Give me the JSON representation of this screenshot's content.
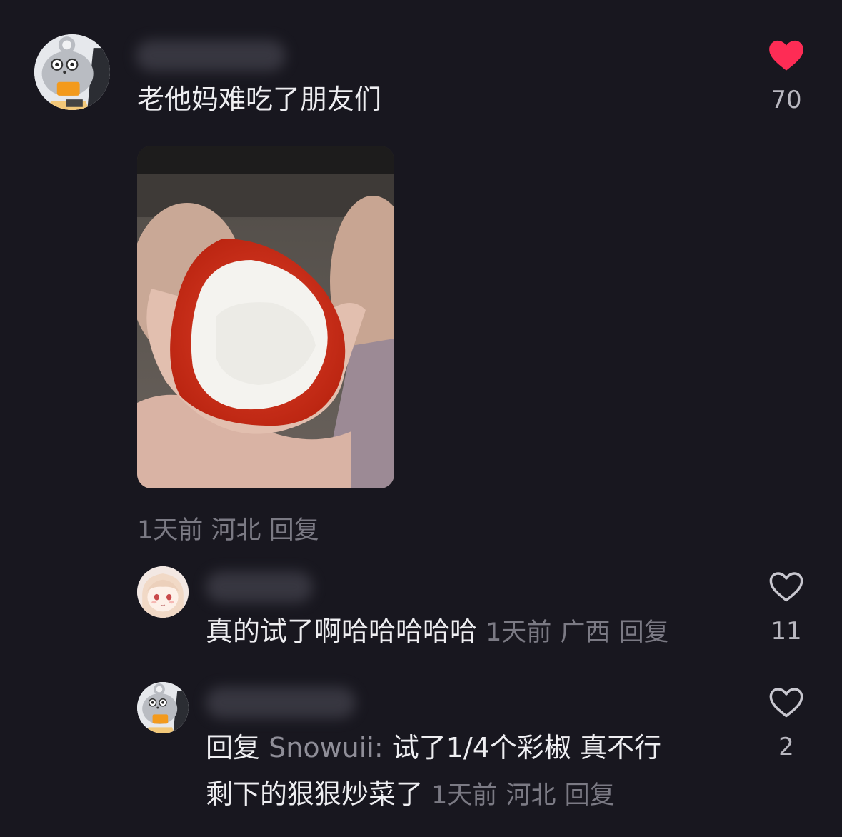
{
  "main_comment": {
    "text": "老他妈难吃了朋友们",
    "time": "1天前",
    "location": "河北",
    "reply_label": "回复",
    "likes": "70",
    "liked": true
  },
  "replies": [
    {
      "text": "真的试了啊哈哈哈哈哈",
      "time": "1天前",
      "location": "广西",
      "reply_label": "回复",
      "likes": "11",
      "liked": false
    },
    {
      "prefix": "回复",
      "reply_to": "Snowuii:",
      "line1": "试了1/4个彩椒 真不行",
      "line2": "剩下的狠狠炒菜了",
      "time": "1天前",
      "location": "河北",
      "reply_label": "回复",
      "likes": "2",
      "liked": false
    }
  ],
  "colors": {
    "background": "#18171f",
    "liked_heart": "#fe2c55",
    "meta_text": "#7b7a84"
  },
  "icons": {
    "liked": "heart-filled-icon",
    "unliked": "heart-outline-icon"
  }
}
